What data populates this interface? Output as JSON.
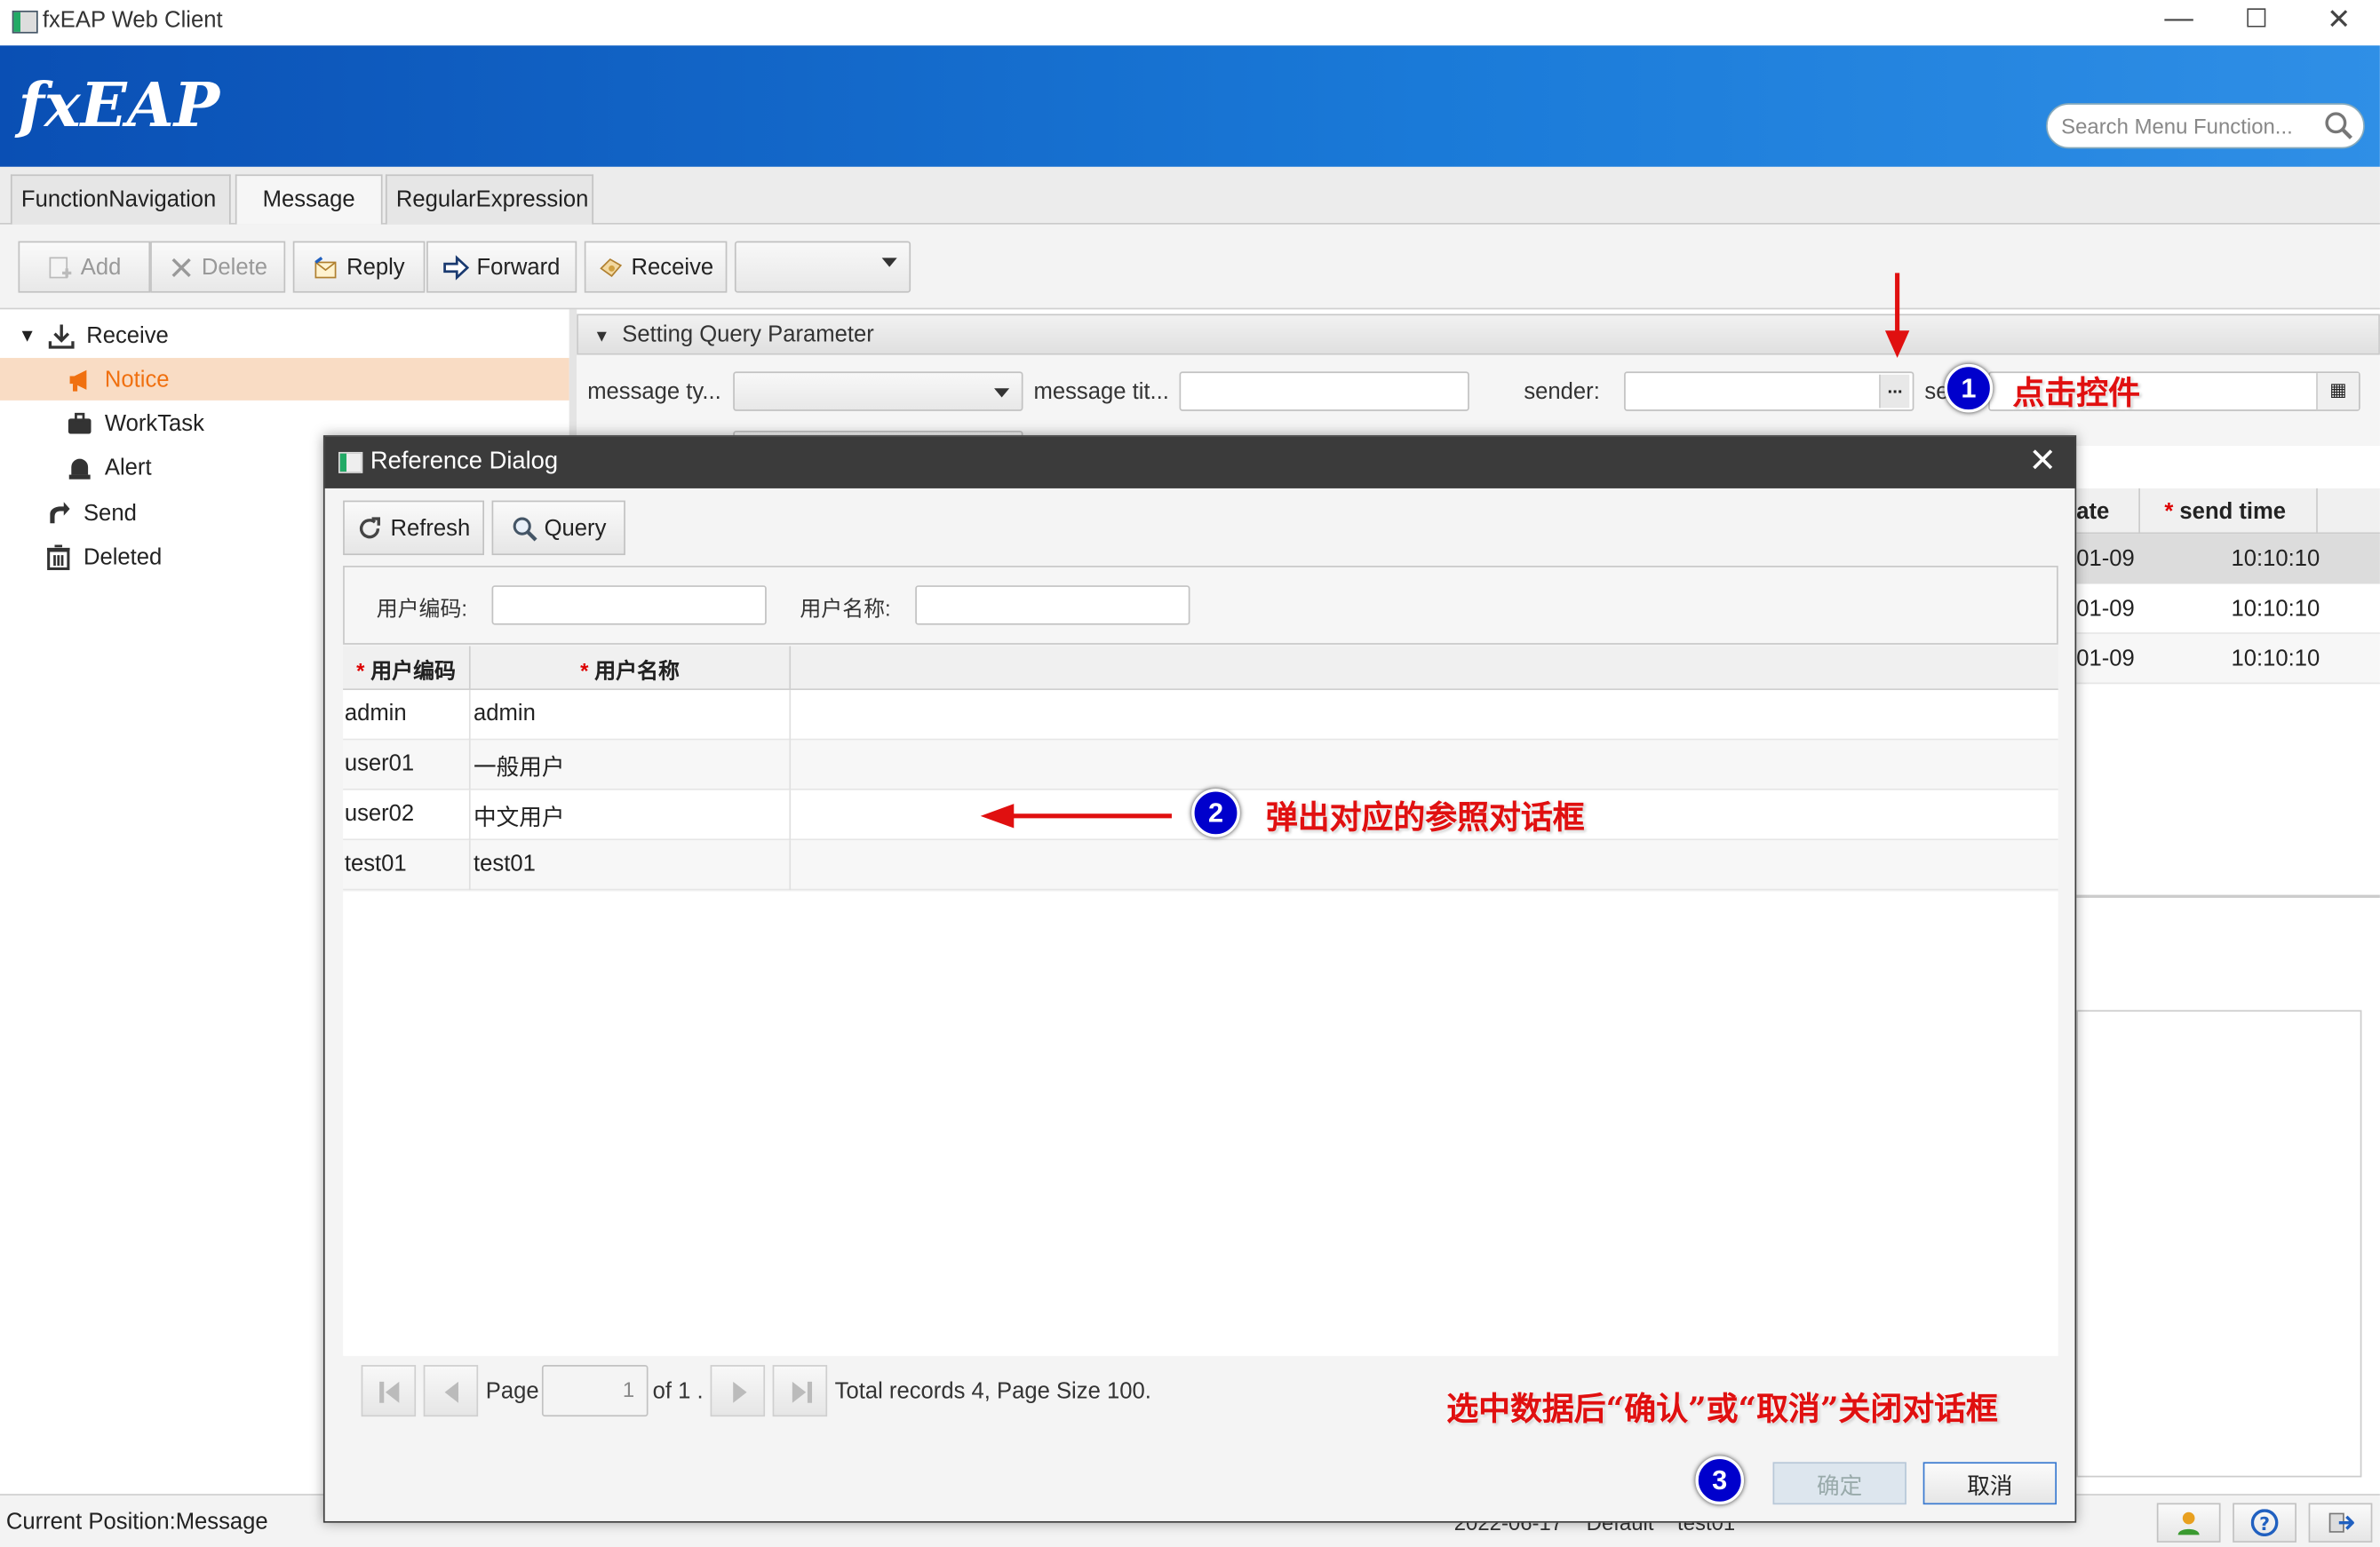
{
  "window": {
    "title": "fxEAP Web Client"
  },
  "header": {
    "logo": "fxEAP",
    "search_placeholder": "Search Menu Function..."
  },
  "tabs": [
    {
      "label": "FunctionNavigation"
    },
    {
      "label": "Message"
    },
    {
      "label": "RegularExpression"
    }
  ],
  "toolbar": {
    "add": "Add",
    "delete": "Delete",
    "reply": "Reply",
    "forward": "Forward",
    "receive": "Receive",
    "select_value": ""
  },
  "tree": {
    "receive": "Receive",
    "notice": "Notice",
    "worktask": "WorkTask",
    "alert": "Alert",
    "send": "Send",
    "deleted": "Deleted"
  },
  "query": {
    "title": "Setting Query Parameter",
    "message_type": "message ty...",
    "message_title": "message tit...",
    "sender": "sender:",
    "se": "se",
    "ellipsis": "..."
  },
  "bg_table": {
    "col_date": "ate",
    "col_send_time": "send time",
    "rows": [
      {
        "date": "01-09",
        "time": "10:10:10"
      },
      {
        "date": "01-09",
        "time": "10:10:10"
      },
      {
        "date": "01-09",
        "time": "10:10:10"
      }
    ]
  },
  "status": {
    "position": "Current Position:Message",
    "hidden_bits": "2022-06-17    Default    test01"
  },
  "dialog": {
    "title": "Reference Dialog",
    "refresh": "Refresh",
    "query": "Query",
    "label_code": "用户编码:",
    "label_name": "用户名称:",
    "col_code": "用户编码",
    "col_name": "用户名称",
    "rows": [
      {
        "code": "admin",
        "name": "admin"
      },
      {
        "code": "user01",
        "name": "一般用户"
      },
      {
        "code": "user02",
        "name": "中文用户"
      },
      {
        "code": "test01",
        "name": "test01"
      }
    ],
    "page_label": "Page",
    "page_value": "1",
    "of_label": "of 1 .",
    "total": "Total records  4, Page Size 100.",
    "ok": "确定",
    "cancel": "取消"
  },
  "annotations": {
    "n1": "1",
    "t1": "点击控件",
    "n2": "2",
    "t2": "弹出对应的参照对话框",
    "n3": "3",
    "t3": "选中数据后“确认”或“取消”关闭对话框"
  },
  "colors": {
    "header_blue": "#0a4fb4",
    "selection": "#f9dcc4",
    "annotation_red": "#e01010",
    "badge_blue": "#0000cc"
  }
}
